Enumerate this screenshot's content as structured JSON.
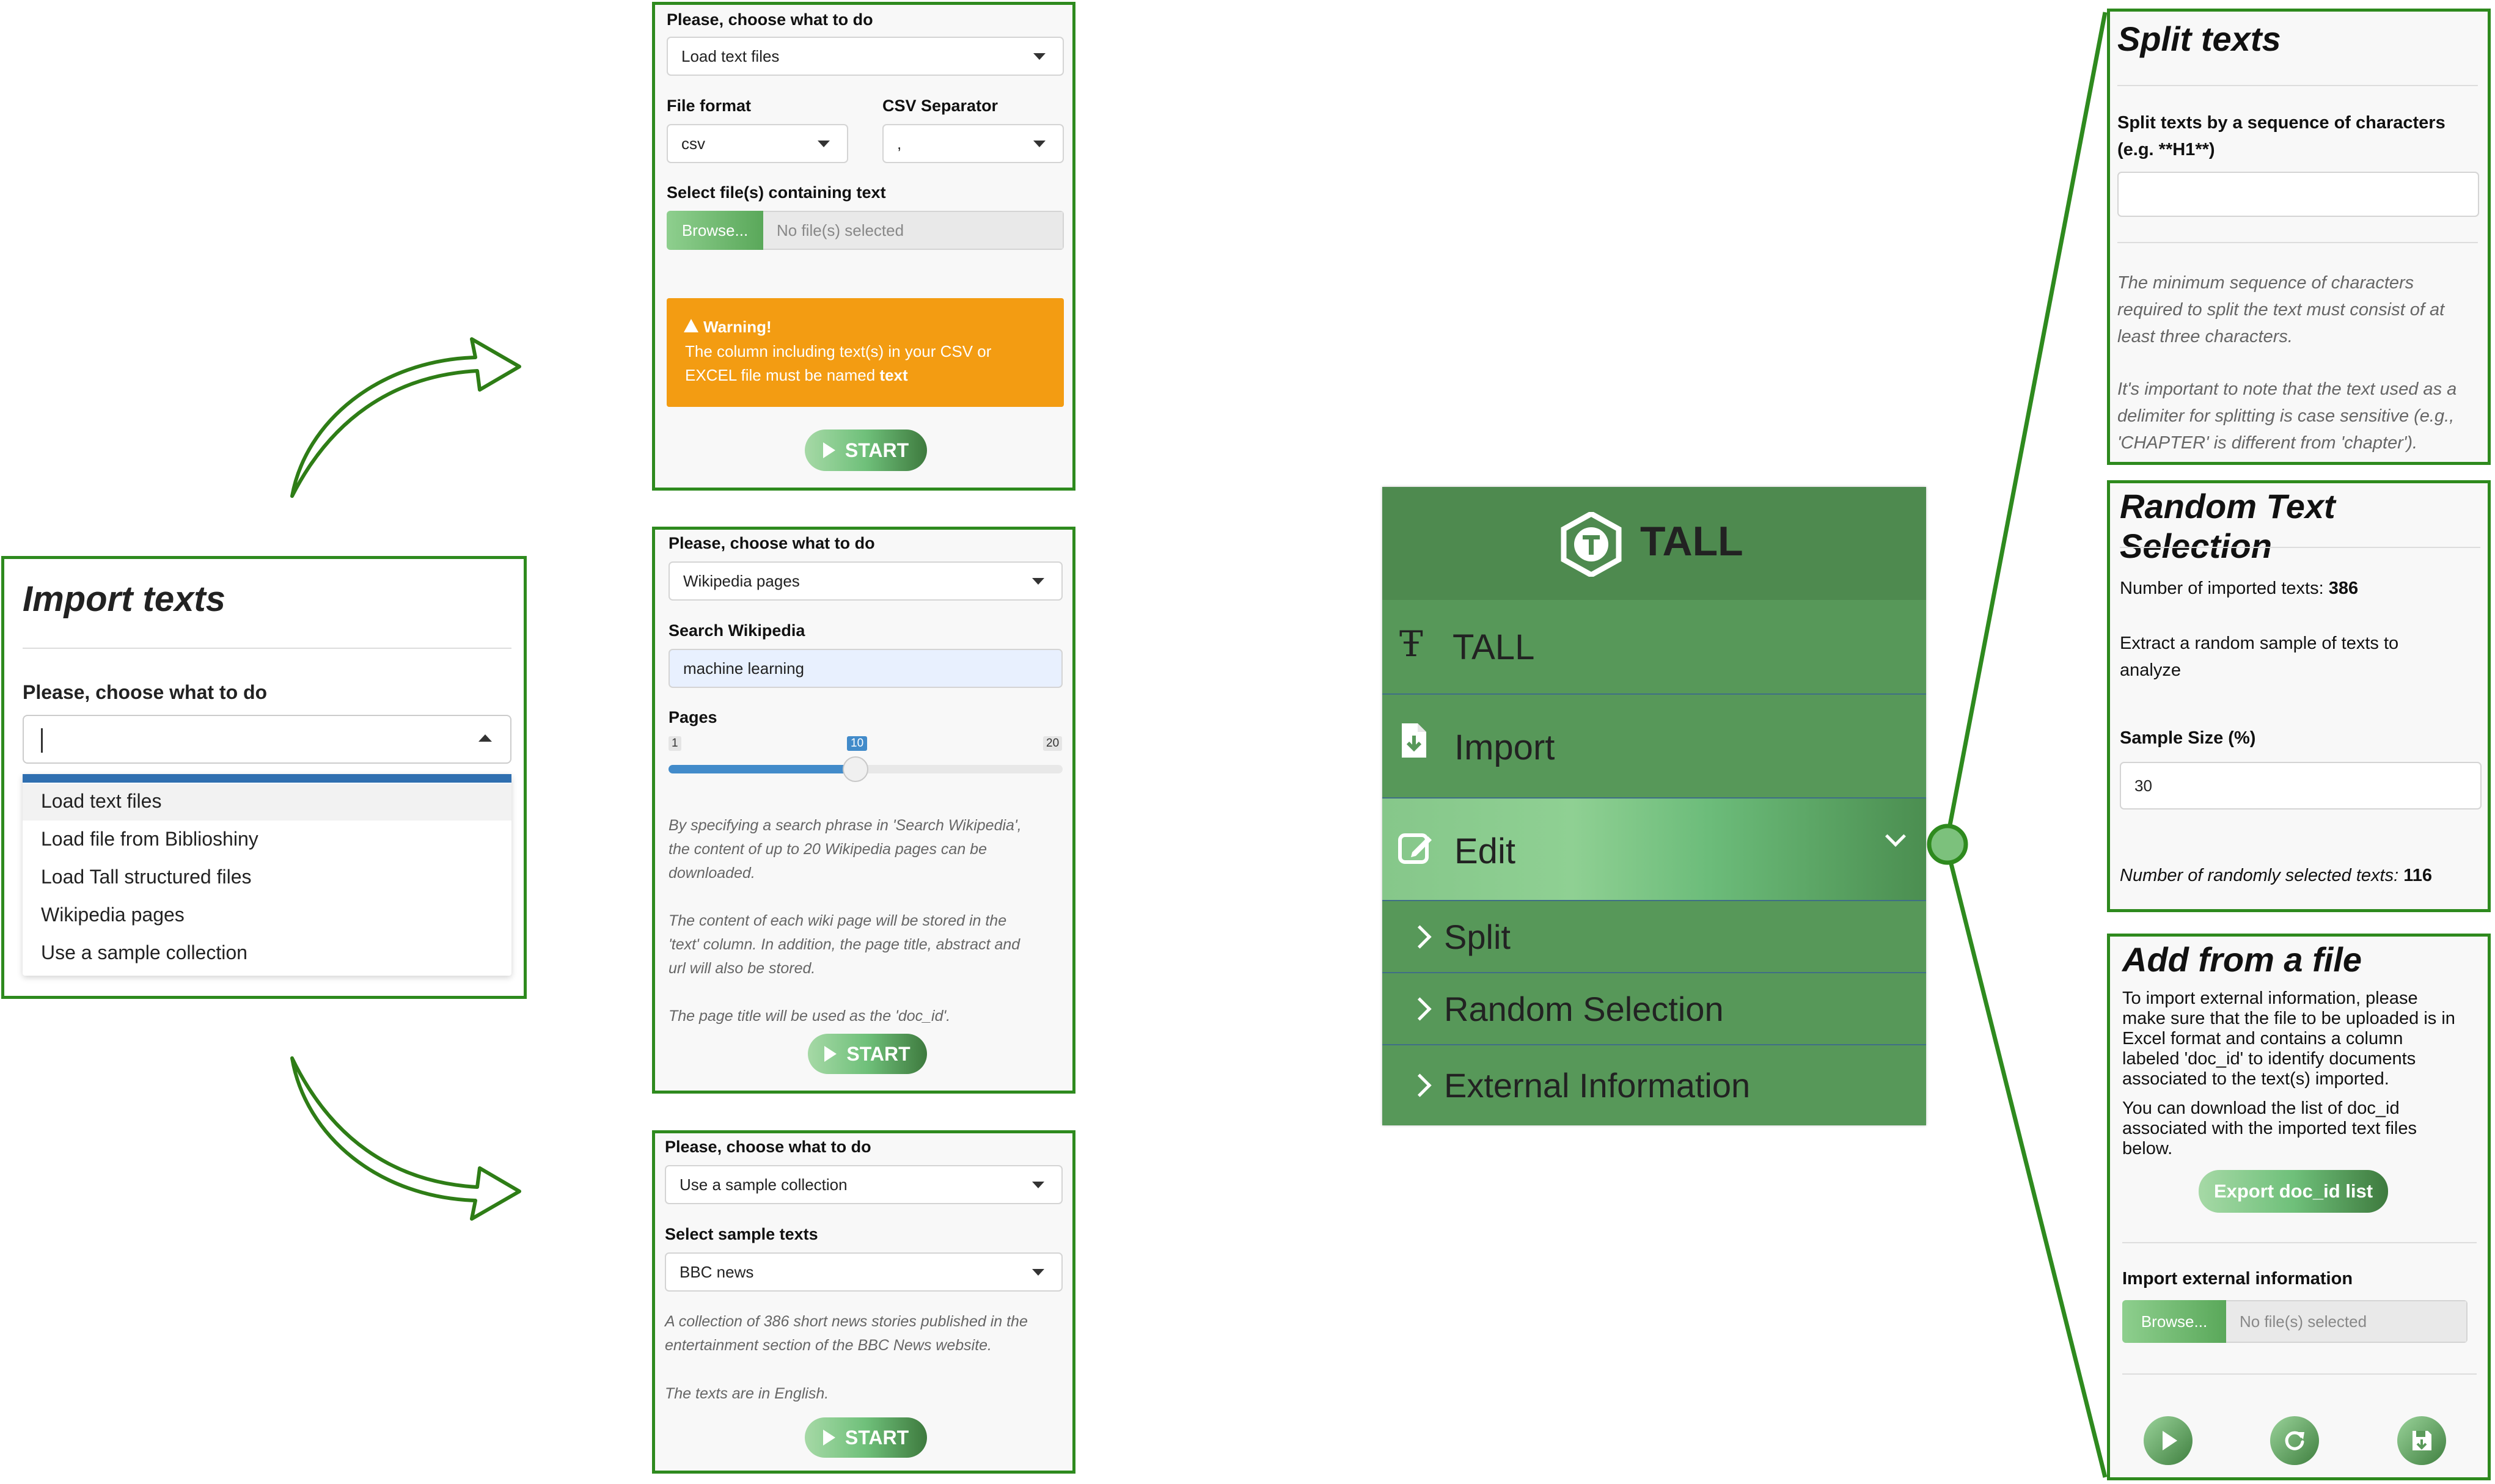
{
  "left_panel": {
    "title": "Import texts",
    "choose_label": "Please, choose what to do",
    "options": [
      "Load text files",
      "Load file from Biblioshiny",
      "Load Tall structured files",
      "Wikipedia pages",
      "Use a sample collection"
    ]
  },
  "mid_top": {
    "choose_label": "Please, choose what to do",
    "choice_value": "Load text files",
    "file_format_label": "File format",
    "file_format_value": "csv",
    "csv_sep_label": "CSV Separator",
    "csv_sep_value": ",",
    "select_files_label": "Select file(s) containing text",
    "browse_label": "Browse...",
    "no_file_text": "No file(s) selected",
    "warning_title": "Warning!",
    "warning_line1": "The column including text(s) in your CSV or",
    "warning_line2_pre": "EXCEL file must be named ",
    "warning_line2_bold": "text",
    "start_label": "START"
  },
  "mid_middle": {
    "choose_label": "Please, choose what to do",
    "choice_value": "Wikipedia pages",
    "search_label": "Search Wikipedia",
    "search_value": "machine learning",
    "pages_label": "Pages",
    "slider_min": "1",
    "slider_value": "10",
    "slider_max": "20",
    "slider_fraction": 0.474,
    "help1": [
      "By specifying a search phrase in 'Search Wikipedia',",
      "the content of up to 20 Wikipedia pages can be",
      "downloaded."
    ],
    "help2": [
      "The content of each wiki page will be stored in the",
      "'text' column. In addition, the page title, abstract and",
      "url will also be stored."
    ],
    "help3": "The page title will be used as the 'doc_id'.",
    "start_label": "START"
  },
  "mid_bottom": {
    "choose_label": "Please, choose what to do",
    "choice_value": "Use a sample collection",
    "select_label": "Select sample texts",
    "select_value": "BBC news",
    "help1": [
      "A collection of 386 short news stories published in the",
      "entertainment section of the BBC News website."
    ],
    "help2": "The texts are in English.",
    "start_label": "START"
  },
  "sidebar": {
    "brand": "TALL",
    "items": [
      "TALL",
      "Import",
      "Edit"
    ],
    "subitems": [
      "Split",
      "Random Selection",
      "External Information"
    ]
  },
  "split_panel": {
    "title": "Split texts",
    "label_line1": "Split texts by a sequence of characters",
    "label_line2": "(e.g. **H1**)",
    "input_value": "",
    "help1": [
      "The minimum sequence of characters",
      "required to split the text must consist of at",
      "least three characters."
    ],
    "help2": [
      "It's important to note that the text used as a",
      "delimiter for splitting is case sensitive (e.g.,",
      "'CHAPTER' is different from 'chapter')."
    ]
  },
  "random_panel": {
    "title": "Random Text Selection",
    "imported_label": "Number of imported texts: ",
    "imported_value": "386",
    "extract_line1": "Extract a random sample of texts to",
    "extract_line2": "analyze",
    "sample_label": "Sample Size (%)",
    "sample_value": "30",
    "selected_label": "Number of randomly selected texts: ",
    "selected_value": "116"
  },
  "file_panel": {
    "title": "Add from a file",
    "para1": [
      "To import external information, please",
      "make sure that the file to be uploaded is in",
      "Excel format and contains a column",
      "labeled 'doc_id' to identify documents",
      "associated to the text(s) imported."
    ],
    "para2": [
      "You can download the list of doc_id",
      "associated with the imported text files",
      "below."
    ],
    "export_label": "Export doc_id list",
    "import_label": "Import external information",
    "browse_label": "Browse...",
    "no_file_text": "No file(s) selected"
  },
  "colors": {
    "panel_border": "#2e8a1e",
    "sidebar_green": "#579859",
    "sidebar_header": "#4e8a4f",
    "warning_orange": "#f39c12",
    "slider_blue": "#428bca"
  },
  "icons": [
    "curved-arrow-up-icon",
    "curved-arrow-down-icon",
    "tall-logo-icon",
    "text-icon",
    "import-icon",
    "edit-icon",
    "chevron-down-icon",
    "chevron-right-icon",
    "play-icon",
    "refresh-icon",
    "save-icon",
    "warning-icon",
    "caret-down-icon"
  ]
}
